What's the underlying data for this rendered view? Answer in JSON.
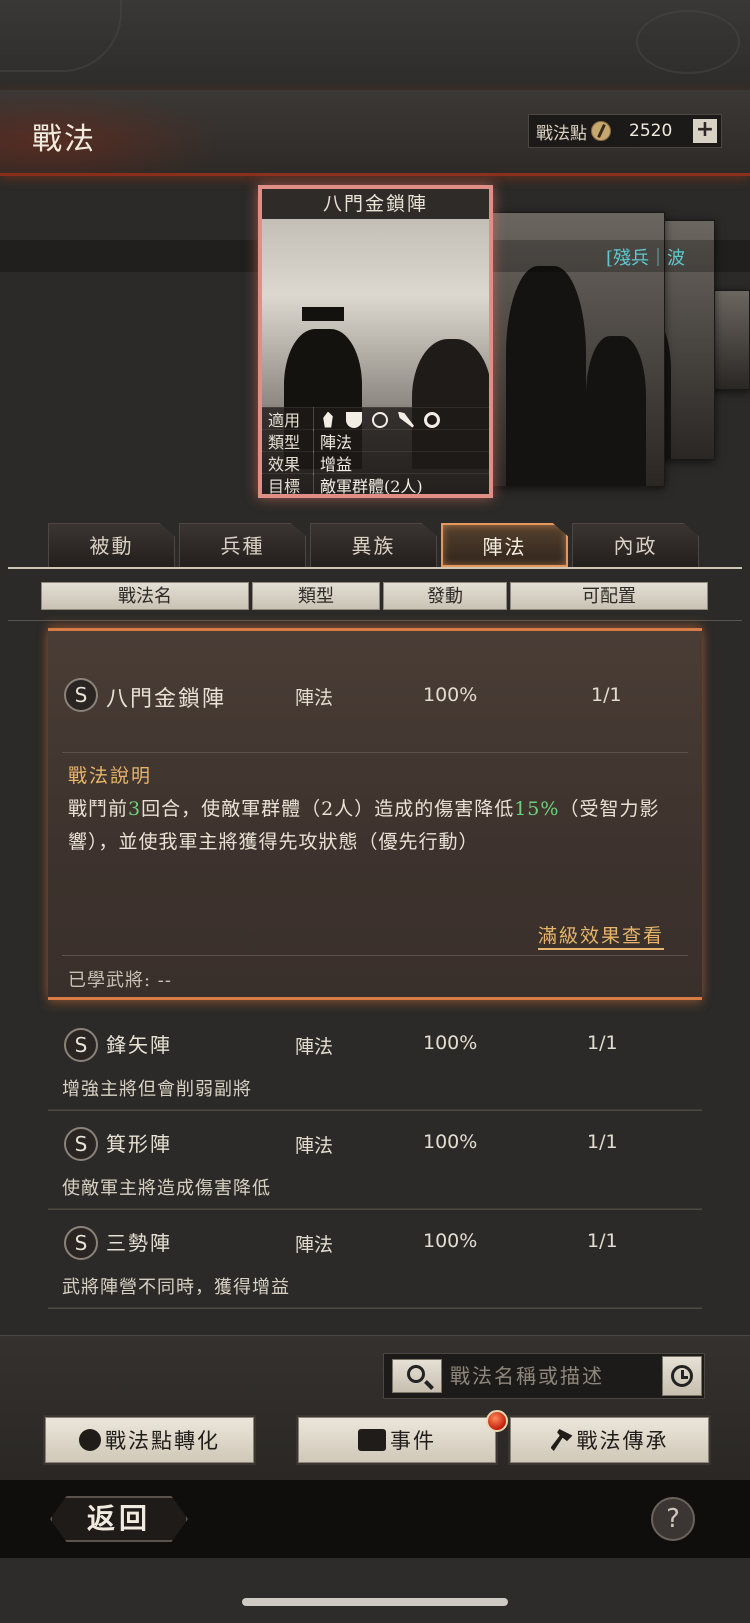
{
  "header": {
    "title": "戰法",
    "points_label": "戰法點",
    "points_value": "2520",
    "plus_label": "+"
  },
  "featured_card": {
    "title": "八門金鎖陣",
    "tags": "[殘兵｜波",
    "info": [
      {
        "key": "適用",
        "value": ""
      },
      {
        "key": "類型",
        "value": "陣法"
      },
      {
        "key": "效果",
        "value": "增益"
      },
      {
        "key": "目標",
        "value": "敵軍群體(2人)"
      }
    ],
    "unit_icons": [
      "horse-icon",
      "shield-icon",
      "bow-icon",
      "spear-icon",
      "wheel-icon"
    ]
  },
  "tabs": [
    {
      "label": "被動",
      "active": false
    },
    {
      "label": "兵種",
      "active": false
    },
    {
      "label": "異族",
      "active": false
    },
    {
      "label": "陣法",
      "active": true
    },
    {
      "label": "內政",
      "active": false
    }
  ],
  "columns": [
    "戰法名",
    "類型",
    "發動",
    "可配置"
  ],
  "expanded_skill": {
    "grade": "S",
    "name": "八門金鎖陣",
    "type": "陣法",
    "rate": "100%",
    "capacity": "1/1",
    "desc_title": "戰法說明",
    "desc_part1": "戰鬥前",
    "desc_rounds": "3",
    "desc_part2": "回合，使敵軍群體（2人）造成的傷害降低",
    "desc_pct": "15%",
    "desc_part3": "（受智力影響），並使我軍主將獲得先攻狀態（優先行動）",
    "max_level_link": "滿級效果查看",
    "learned_generals": "已學武將: --"
  },
  "skills": [
    {
      "grade": "S",
      "name": "鋒矢陣",
      "type": "陣法",
      "rate": "100%",
      "capacity": "1/1",
      "desc": "增強主將但會削弱副將"
    },
    {
      "grade": "S",
      "name": "箕形陣",
      "type": "陣法",
      "rate": "100%",
      "capacity": "1/1",
      "desc": "使敵軍主將造成傷害降低"
    },
    {
      "grade": "S",
      "name": "三勢陣",
      "type": "陣法",
      "rate": "100%",
      "capacity": "1/1",
      "desc": "武將陣營不同時，獲得增益"
    }
  ],
  "search": {
    "placeholder": "戰法名稱或描述"
  },
  "actions": {
    "convert": "戰法點轉化",
    "events": "事件",
    "inherit": "戰法傳承"
  },
  "footer": {
    "back": "返回",
    "help": "?"
  },
  "colors": {
    "accent": "#e4985e",
    "highlight": "#6fd07c",
    "gold": "#e6b46a",
    "tag": "#5ec9cf"
  }
}
